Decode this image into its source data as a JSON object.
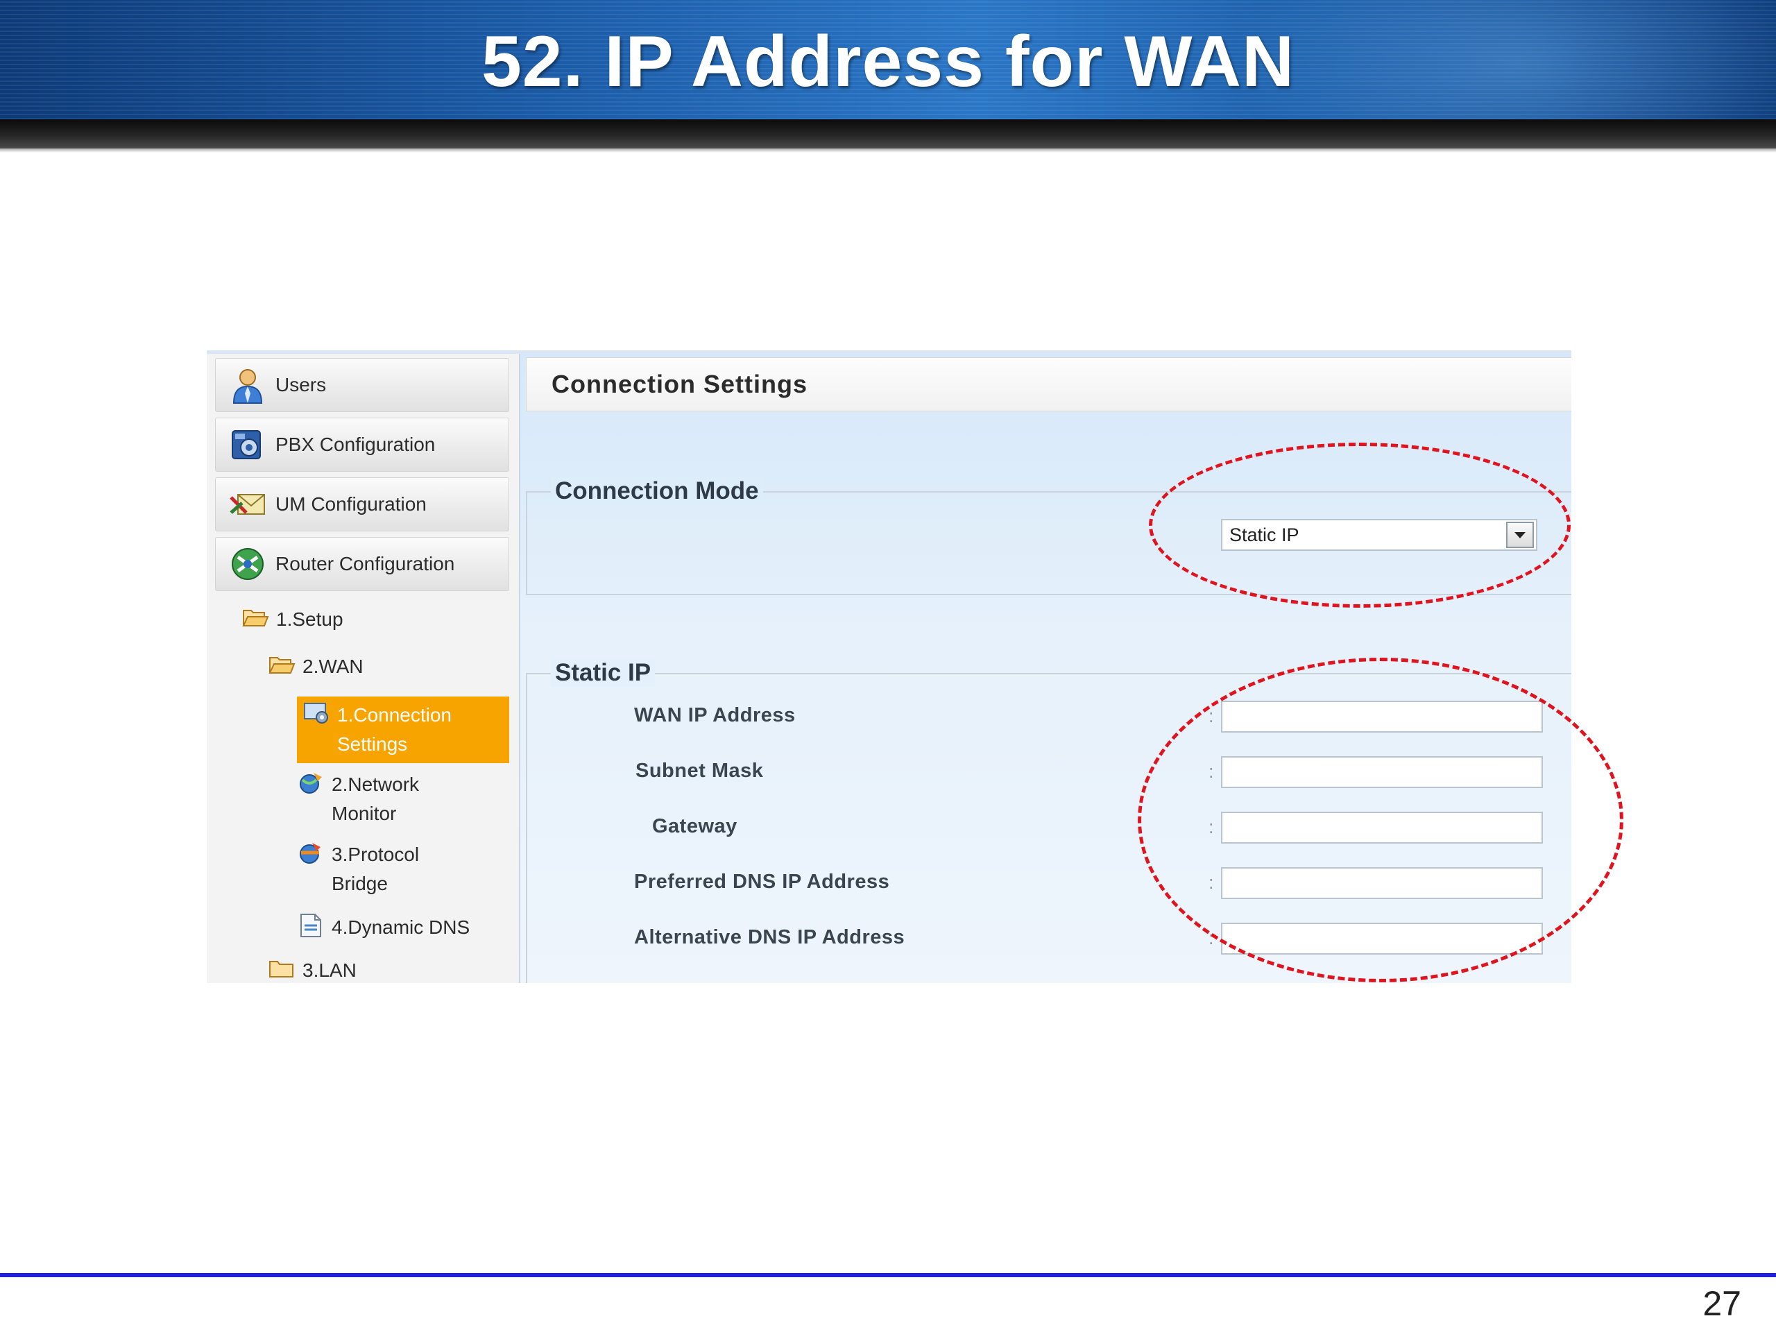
{
  "slide": {
    "title": "52. IP Address for WAN",
    "page_number": "27"
  },
  "sidebar": {
    "nav_items": [
      {
        "label": "Users",
        "icon": "user-icon"
      },
      {
        "label": "PBX Configuration",
        "icon": "pbx-icon"
      },
      {
        "label": "UM Configuration",
        "icon": "um-mail-icon"
      },
      {
        "label": "Router Configuration",
        "icon": "router-icon"
      }
    ],
    "tree": [
      {
        "label": "1.Setup",
        "icon": "folder-open-icon"
      },
      {
        "label": "2.WAN",
        "icon": "folder-open-icon"
      },
      {
        "label_line1": "1.Connection",
        "label_line2": "Settings",
        "icon": "connection-settings-icon",
        "active": true
      },
      {
        "label_line1": "2.Network",
        "label_line2": "Monitor",
        "icon": "network-monitor-icon"
      },
      {
        "label_line1": "3.Protocol",
        "label_line2": "Bridge",
        "icon": "protocol-bridge-icon"
      },
      {
        "label": "4.Dynamic DNS",
        "icon": "dynamic-dns-icon"
      },
      {
        "label": "3.LAN",
        "icon": "folder-icon"
      }
    ]
  },
  "main": {
    "title": "Connection Settings",
    "connection_mode": {
      "legend": "Connection Mode",
      "selected_value": "Static IP"
    },
    "static_ip": {
      "legend": "Static IP",
      "fields": [
        {
          "label": "WAN IP Address",
          "value": ""
        },
        {
          "label": "Subnet Mask",
          "value": ""
        },
        {
          "label": "Gateway",
          "value": ""
        },
        {
          "label": "Preferred DNS IP Address",
          "value": ""
        },
        {
          "label": "Alternative DNS IP Address",
          "value": ""
        }
      ]
    },
    "separator": ":"
  },
  "colors": {
    "highlight": "#f7a300",
    "annotation": "#e0141e",
    "footer_line": "#1e1ee6"
  }
}
